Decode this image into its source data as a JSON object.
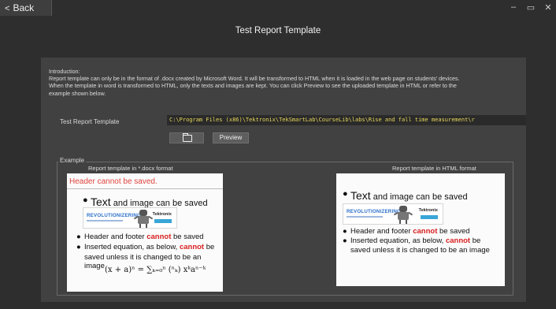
{
  "window": {
    "back_label": "Back",
    "title": "Test Report Template",
    "controls": {
      "minimize": "–",
      "restore": "▭",
      "close": "✕"
    }
  },
  "intro": {
    "heading": "Introduction:",
    "line1": "Report template can only be in the format of .docx created by Microsoft Word. It will be transformed to HTML when it is loaded in the web page on students' devices.",
    "line2": "When the template in word is transformed to HTML, only the texts and images are kept. You can click Preview to see the uploaded template in HTML or refer to the",
    "line3": "example shown below."
  },
  "template": {
    "label": "Test Report Template",
    "path_value": "C:\\Program Files (x86)\\Tektronix\\TekSmartLab\\CourseLib\\labs\\Rise and fall time measurement\\r",
    "browse_icon": "folder-icon",
    "preview_label": "Preview"
  },
  "example": {
    "legend": "Example",
    "docx_caption": "Report template in *.docx format",
    "html_caption": "Report template in HTML format",
    "docx": {
      "header_warning": "Header cannot be saved.",
      "bullet1": "Text and image can be saved.",
      "bullet1_big": "Text",
      "bullet1_rest": " and image can be saved",
      "bullet2_pre": "Header and footer ",
      "bullet2_red": "cannot",
      "bullet2_post": " be saved",
      "bullet3_pre": "Inserted equation, as below, ",
      "bullet3_red": "cannot",
      "bullet3_post": " be",
      "bullet3_line2": "saved unless it is changed to be an image",
      "equation": "(x + a)ⁿ = ∑ₖ₌₀ⁿ (ⁿₖ) xᵏaⁿ⁻ᵏ"
    },
    "html": {
      "bullet1_big": "Text",
      "bullet1_rest": " and image can be saved",
      "bullet2_pre": "Header and footer ",
      "bullet2_red": "cannot",
      "bullet2_post": " be saved",
      "bullet3_pre": "Inserted equation, as below, ",
      "bullet3_red": "cannot",
      "bullet3_post": " be",
      "bullet3_line2": "saved unless it is changed to be an image"
    },
    "logo_text": "REVOLUTIONIZERING",
    "brand_text": "Tektronix"
  }
}
